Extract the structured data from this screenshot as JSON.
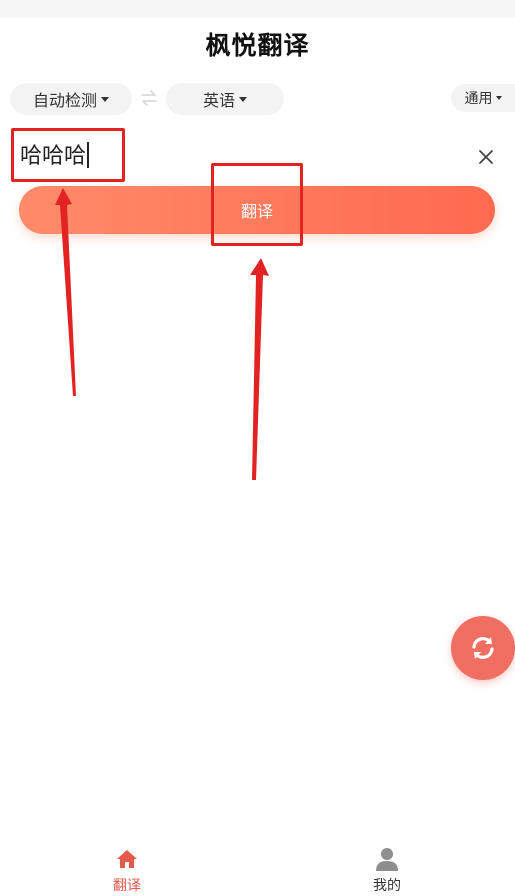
{
  "app": {
    "title": "枫悦翻译"
  },
  "languages": {
    "source": "自动检测",
    "target": "英语",
    "domain": "通用"
  },
  "input": {
    "value": "哈哈哈"
  },
  "actions": {
    "translate_label": "翻译"
  },
  "tabbar": {
    "items": [
      {
        "label": "翻译",
        "icon": "home-icon",
        "active": true
      },
      {
        "label": "我的",
        "icon": "user-icon",
        "active": false
      }
    ]
  },
  "colors": {
    "accent": "#ff6a4f",
    "accent_light": "#ff8b6a",
    "fab": "#f06e62",
    "active_tab": "#e65a4a",
    "annotation": "#e32222"
  }
}
